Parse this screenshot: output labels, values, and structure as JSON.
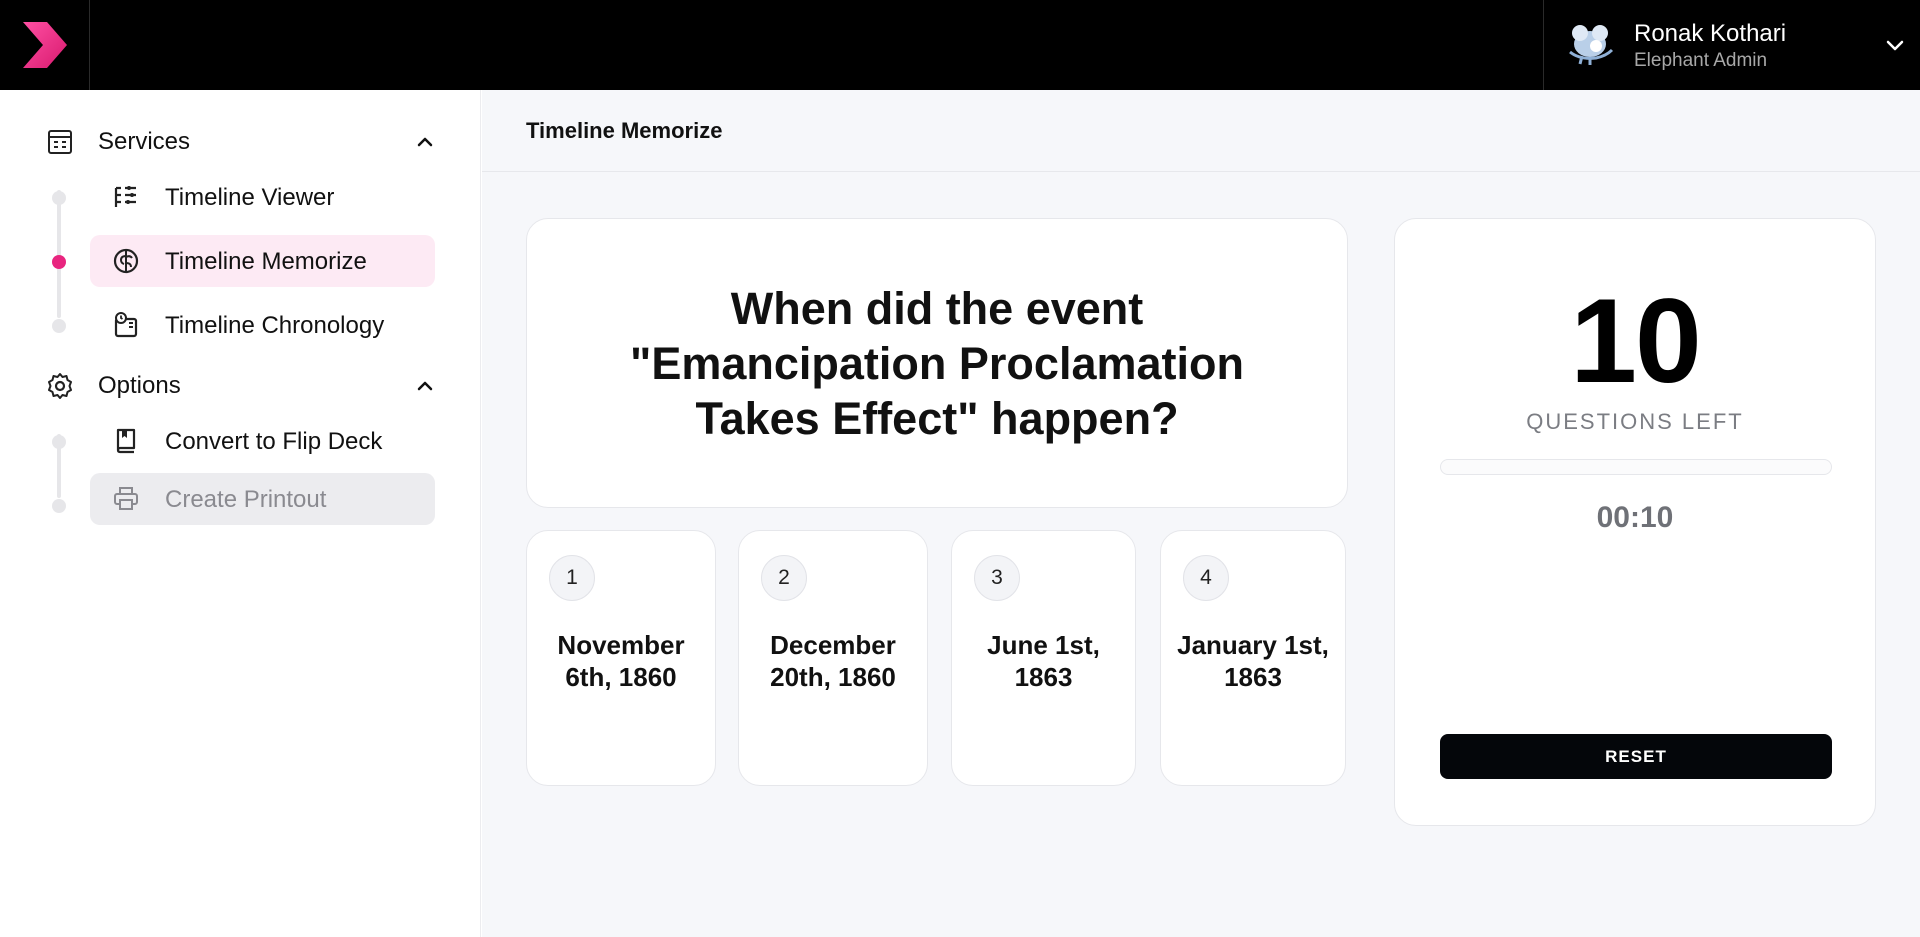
{
  "header": {
    "user": {
      "name": "Ronak Kothari",
      "role": "Elephant Admin"
    }
  },
  "sidebar": {
    "sections": [
      {
        "label": "Services",
        "icon": "calculator-icon",
        "items": [
          {
            "label": "Timeline Viewer",
            "icon": "list-filter-icon",
            "state": "default"
          },
          {
            "label": "Timeline Memorize",
            "icon": "brain-icon",
            "state": "active"
          },
          {
            "label": "Timeline Chronology",
            "icon": "timer-board-icon",
            "state": "default"
          }
        ]
      },
      {
        "label": "Options",
        "icon": "gear-icon",
        "items": [
          {
            "label": "Convert to Flip Deck",
            "icon": "book-icon",
            "state": "default"
          },
          {
            "label": "Create Printout",
            "icon": "printer-icon",
            "state": "disabled"
          }
        ]
      }
    ]
  },
  "main": {
    "title": "Timeline Memorize",
    "question": "When did the event \"Emancipation Proclamation Takes Effect\" happen?",
    "answers": [
      {
        "number": "1",
        "date": "November 6th, 1860"
      },
      {
        "number": "2",
        "date": "December 20th, 1860"
      },
      {
        "number": "3",
        "date": "June 1st, 1863"
      },
      {
        "number": "4",
        "date": "January 1st, 1863"
      }
    ],
    "status": {
      "count": "10",
      "count_label": "QUESTIONS LEFT",
      "progress": 0,
      "timer": "00:10",
      "reset_label": "RESET"
    }
  },
  "colors": {
    "accent": "#e8257f",
    "topbar": "#000000",
    "active_bg": "#fdeaf4"
  }
}
